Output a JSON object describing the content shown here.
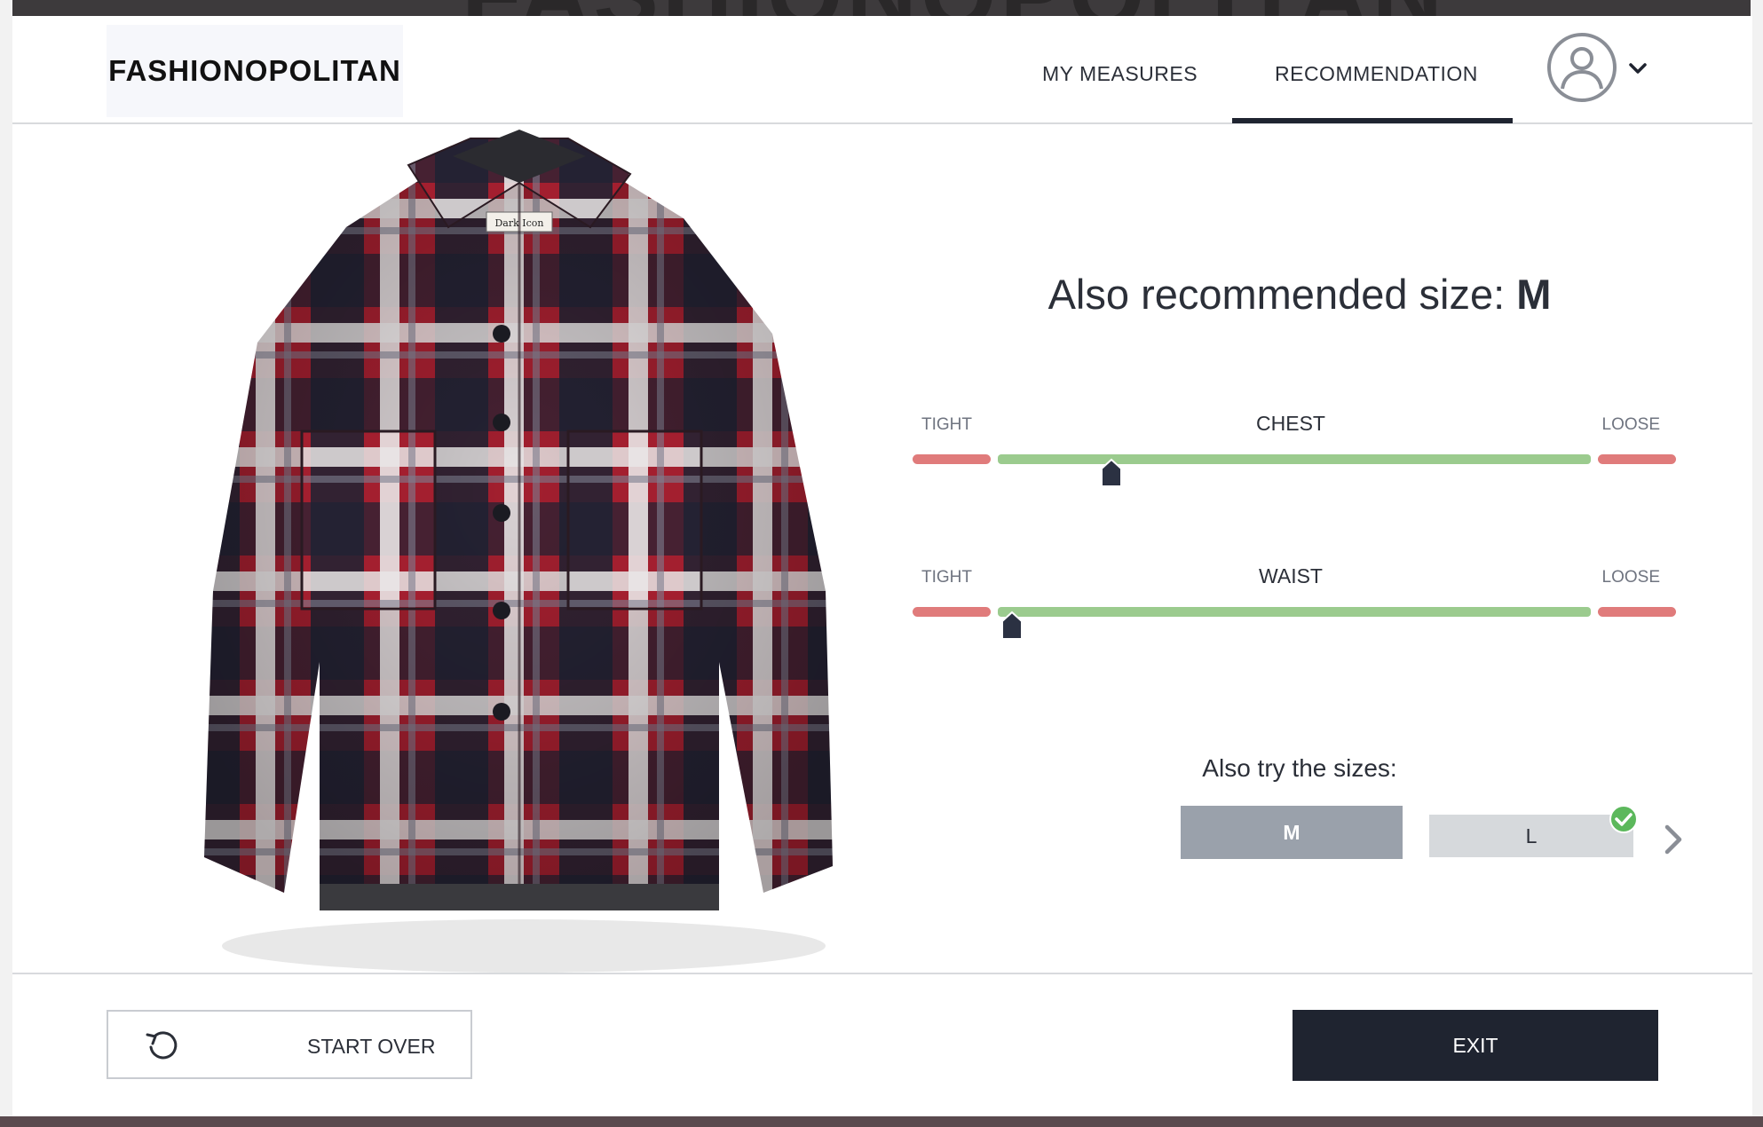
{
  "background": {
    "title": "FASHIONOPOLITAN"
  },
  "header": {
    "logo": "FASHIONOPOLITAN",
    "tabs": [
      {
        "label": "MY MEASURES",
        "active": false
      },
      {
        "label": "RECOMMENDATION",
        "active": true
      }
    ],
    "avatar_icon": "user-avatar-icon",
    "menu_icon": "chevron-down-icon"
  },
  "product": {
    "image": "plaid flannel shirt jacket",
    "tag_text": "Dark Icon"
  },
  "recommendation": {
    "title_prefix": "Also recommended size:",
    "size": "M"
  },
  "fit": [
    {
      "name": "CHEST",
      "tight_label": "TIGHT",
      "loose_label": "LOOSE",
      "position": 0.26
    },
    {
      "name": "WAIST",
      "tight_label": "TIGHT",
      "loose_label": "LOOSE",
      "position": 0.13
    }
  ],
  "sizes": {
    "label": "Also try the sizes:",
    "options": [
      {
        "label": "M",
        "selected": true
      },
      {
        "label": "L",
        "selected": false,
        "checked": true
      }
    ]
  },
  "footer": {
    "start_over_label": "START OVER",
    "exit_label": "EXIT"
  },
  "colors": {
    "dark": "#1f2430",
    "green": "#9bcb8e",
    "red": "#e07b7b",
    "check": "#5cb85c"
  }
}
